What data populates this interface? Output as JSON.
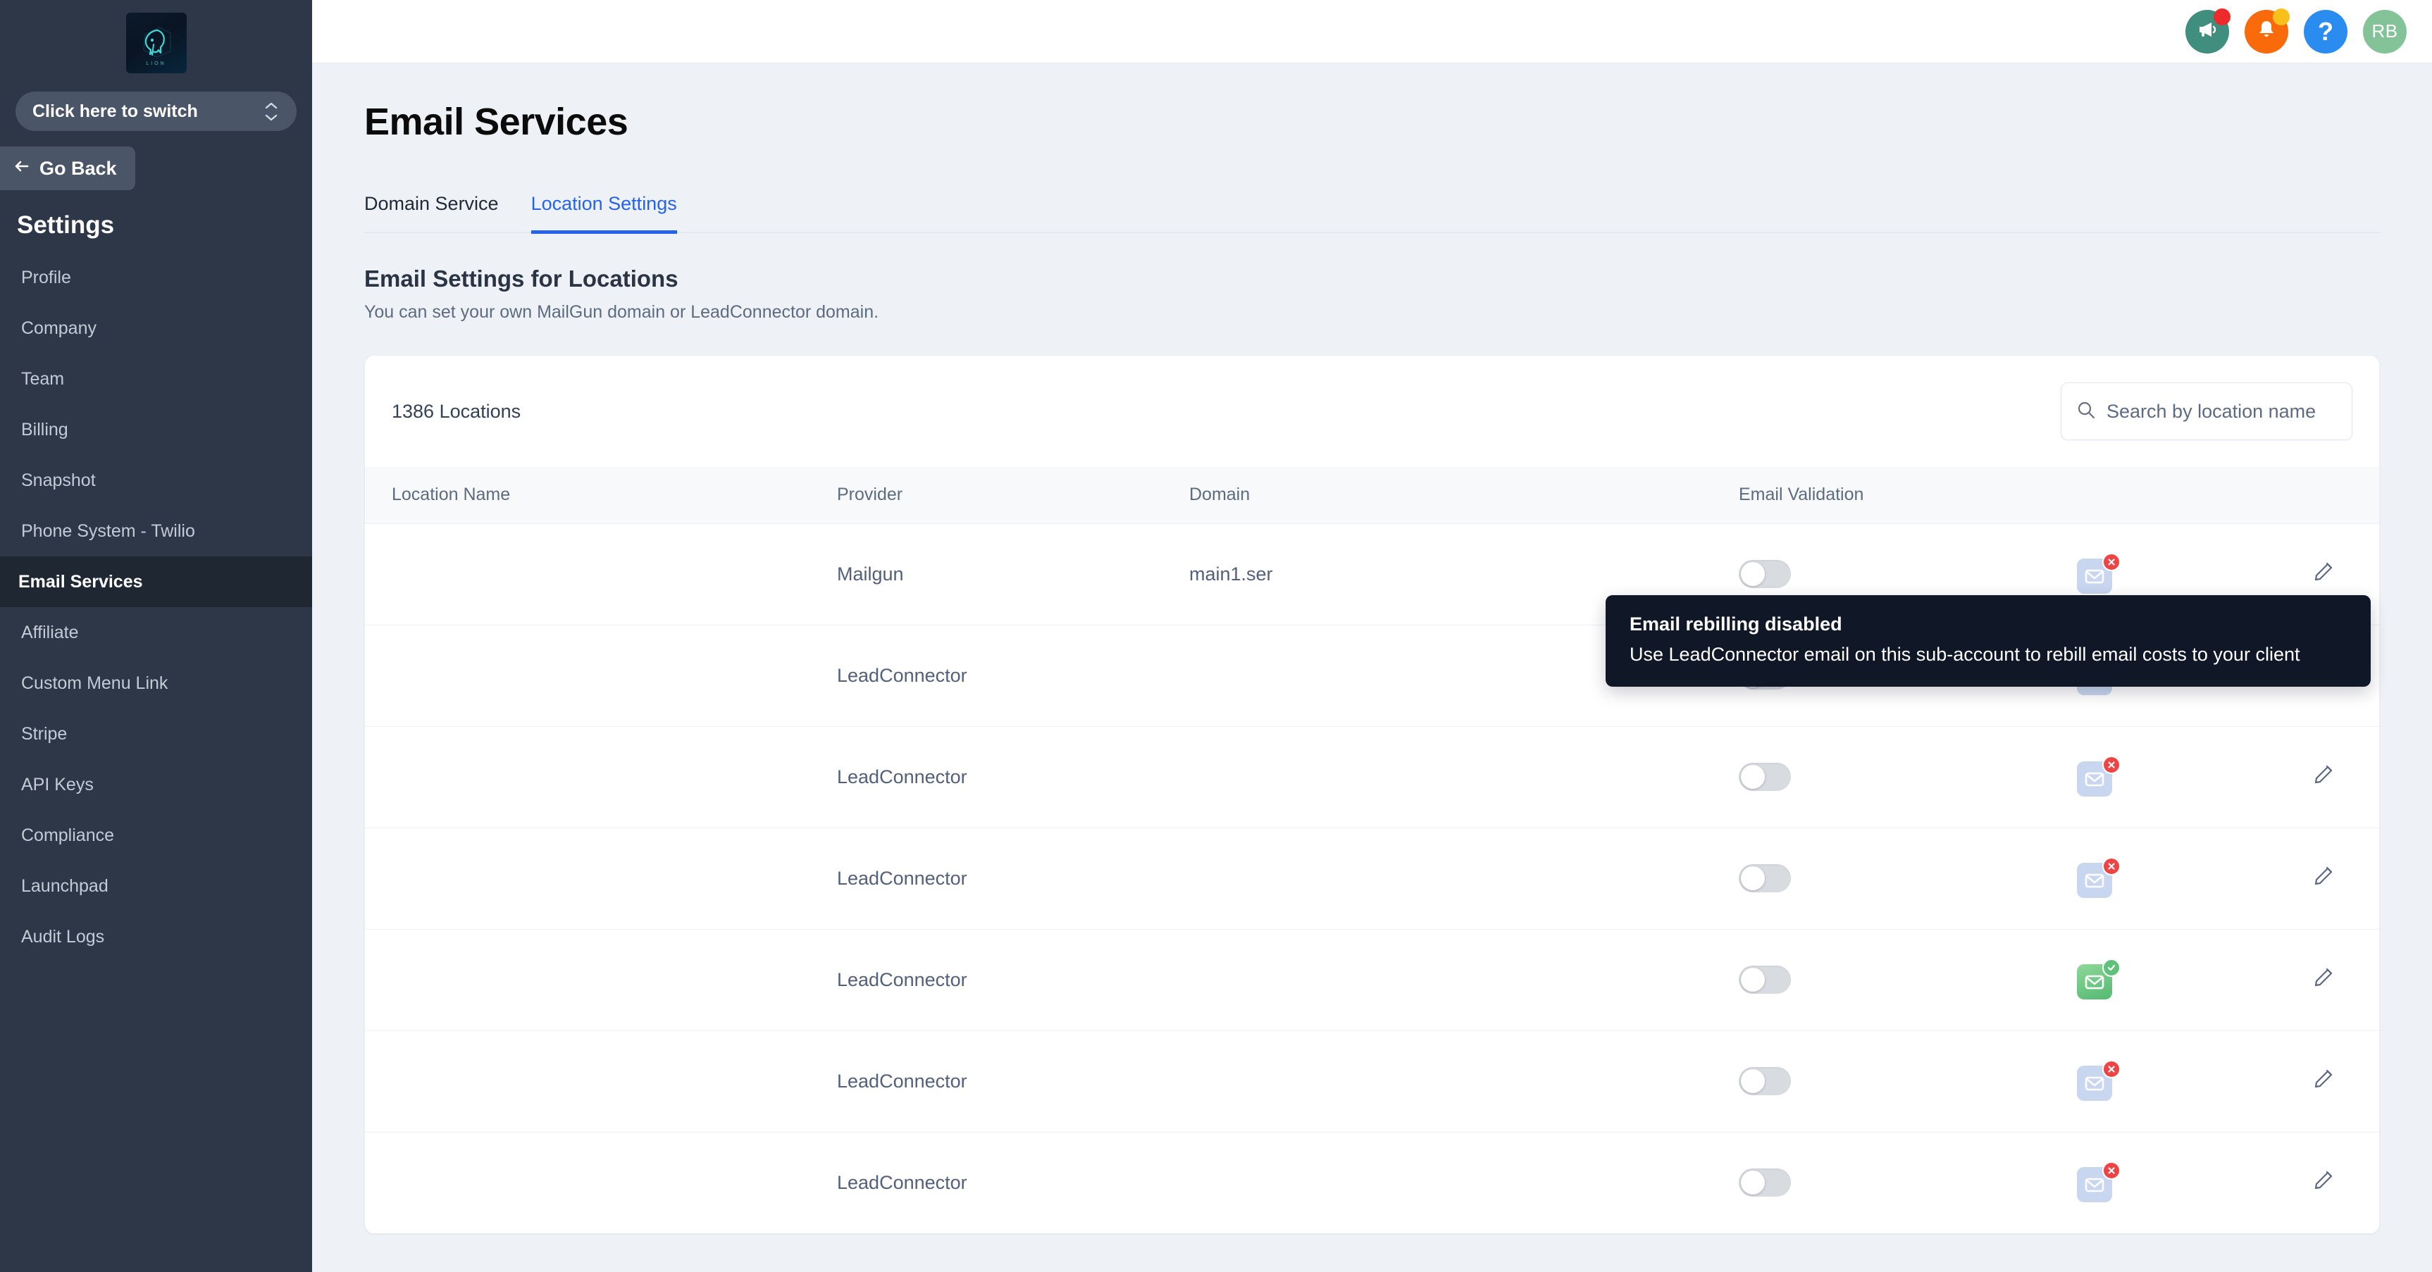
{
  "sidebar": {
    "logo_text": "LION",
    "switch_label": "Click here to switch",
    "go_back_label": "Go Back",
    "section_title": "Settings",
    "items": [
      {
        "label": "Profile",
        "active": false
      },
      {
        "label": "Company",
        "active": false
      },
      {
        "label": "Team",
        "active": false
      },
      {
        "label": "Billing",
        "active": false
      },
      {
        "label": "Snapshot",
        "active": false
      },
      {
        "label": "Phone System - Twilio",
        "active": false
      },
      {
        "label": "Email Services",
        "active": true
      },
      {
        "label": "Affiliate",
        "active": false
      },
      {
        "label": "Custom Menu Link",
        "active": false
      },
      {
        "label": "Stripe",
        "active": false
      },
      {
        "label": "API Keys",
        "active": false
      },
      {
        "label": "Compliance",
        "active": false
      },
      {
        "label": "Launchpad",
        "active": false
      },
      {
        "label": "Audit Logs",
        "active": false
      }
    ]
  },
  "topbar": {
    "icons": [
      {
        "name": "megaphone-icon",
        "color": "#3f8e7e",
        "badge_color": "#ee2b2b"
      },
      {
        "name": "bell-icon",
        "color": "#f96a0b",
        "badge_color": "#f9bf1b"
      },
      {
        "name": "help-icon",
        "color": "#2b8cf0",
        "glyph": "?"
      },
      {
        "name": "avatar",
        "color": "#84c398",
        "initials": "RB"
      }
    ]
  },
  "page": {
    "title": "Email Services",
    "tabs": [
      {
        "label": "Domain Service",
        "active": false
      },
      {
        "label": "Location Settings",
        "active": true
      }
    ],
    "section_title": "Email Settings for Locations",
    "section_subtitle": "You can set your own MailGun domain or LeadConnector domain."
  },
  "table_card": {
    "count_label": "1386 Locations",
    "search": {
      "placeholder": "Search by location name"
    },
    "columns": [
      "Location Name",
      "Provider",
      "Domain",
      "Email Validation",
      "",
      ""
    ],
    "rows": [
      {
        "location_name": "",
        "provider": "Mailgun",
        "domain": "main1.ser",
        "validation_toggle": "off",
        "mail_status": "invalid"
      },
      {
        "location_name": "",
        "provider": "LeadConnector",
        "domain": "",
        "validation_toggle": "off",
        "mail_status": "invalid"
      },
      {
        "location_name": "",
        "provider": "LeadConnector",
        "domain": "",
        "validation_toggle": "off",
        "mail_status": "invalid"
      },
      {
        "location_name": "",
        "provider": "LeadConnector",
        "domain": "",
        "validation_toggle": "off",
        "mail_status": "invalid"
      },
      {
        "location_name": "",
        "provider": "LeadConnector",
        "domain": "",
        "validation_toggle": "off",
        "mail_status": "valid"
      },
      {
        "location_name": "",
        "provider": "LeadConnector",
        "domain": "",
        "validation_toggle": "off",
        "mail_status": "invalid"
      },
      {
        "location_name": "",
        "provider": "LeadConnector",
        "domain": "",
        "validation_toggle": "off",
        "mail_status": "invalid"
      }
    ]
  },
  "tooltip": {
    "title": "Email rebilling disabled",
    "body": "Use LeadConnector email on this sub-account to rebill email costs to your client"
  },
  "colors": {
    "accent": "#2563eb",
    "sidebar_bg": "#2d3748",
    "tooltip_bg": "#101828",
    "status_invalid": "#ef4444",
    "status_valid": "#5ec27a"
  }
}
